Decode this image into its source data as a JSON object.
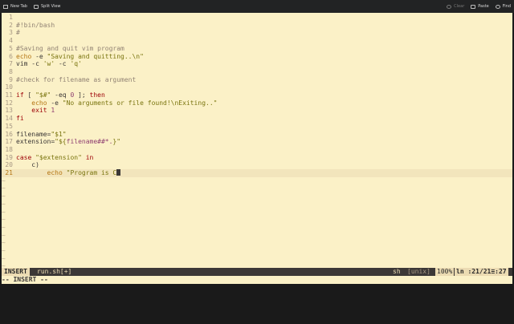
{
  "toolbar": {
    "new_tab": "New Tab",
    "split_view": "Split View",
    "clear": "Clear",
    "paste": "Paste",
    "find": "Find"
  },
  "editor": {
    "lines": [
      {
        "n": "1",
        "tokens": []
      },
      {
        "n": "2",
        "tokens": [
          {
            "c": "cm",
            "t": "#!bin/bash"
          }
        ]
      },
      {
        "n": "3",
        "tokens": [
          {
            "c": "cm",
            "t": "#"
          }
        ]
      },
      {
        "n": "4",
        "tokens": []
      },
      {
        "n": "5",
        "tokens": [
          {
            "c": "cm",
            "t": "#Saving and quit vim program"
          }
        ]
      },
      {
        "n": "6",
        "tokens": [
          {
            "c": "fn",
            "t": "echo"
          },
          {
            "c": "",
            "t": " -e "
          },
          {
            "c": "st",
            "t": "\"Saving and quitting..\\n\""
          }
        ]
      },
      {
        "n": "7",
        "tokens": [
          {
            "c": "",
            "t": "vim -c "
          },
          {
            "c": "st",
            "t": "'w'"
          },
          {
            "c": "",
            "t": " -c "
          },
          {
            "c": "st",
            "t": "'q'"
          }
        ]
      },
      {
        "n": "8",
        "tokens": []
      },
      {
        "n": "9",
        "tokens": [
          {
            "c": "cm",
            "t": "#check for filename as argument"
          }
        ]
      },
      {
        "n": "10",
        "tokens": []
      },
      {
        "n": "11",
        "tokens": [
          {
            "c": "kw",
            "t": "if"
          },
          {
            "c": "",
            "t": " [ "
          },
          {
            "c": "st",
            "t": "\"$#\""
          },
          {
            "c": "",
            "t": " -eq "
          },
          {
            "c": "nm",
            "t": "0"
          },
          {
            "c": "",
            "t": " ]; "
          },
          {
            "c": "kw",
            "t": "then"
          }
        ]
      },
      {
        "n": "12",
        "tokens": [
          {
            "c": "",
            "t": "    "
          },
          {
            "c": "fn",
            "t": "echo"
          },
          {
            "c": "",
            "t": " -e "
          },
          {
            "c": "st",
            "t": "\"No arguments or file found!\\nExiting..\""
          }
        ]
      },
      {
        "n": "13",
        "tokens": [
          {
            "c": "",
            "t": "    "
          },
          {
            "c": "kw",
            "t": "exit"
          },
          {
            "c": "",
            "t": " "
          },
          {
            "c": "nm",
            "t": "1"
          }
        ]
      },
      {
        "n": "14",
        "tokens": [
          {
            "c": "kw",
            "t": "fi"
          }
        ]
      },
      {
        "n": "15",
        "tokens": []
      },
      {
        "n": "16",
        "tokens": [
          {
            "c": "",
            "t": "filename="
          },
          {
            "c": "st",
            "t": "\"$1\""
          }
        ]
      },
      {
        "n": "17",
        "tokens": [
          {
            "c": "",
            "t": "extension="
          },
          {
            "c": "st",
            "t": "\"${"
          },
          {
            "c": "ex",
            "t": "filename##*."
          },
          {
            "c": "st",
            "t": "}\""
          }
        ]
      },
      {
        "n": "18",
        "tokens": []
      },
      {
        "n": "19",
        "tokens": [
          {
            "c": "kw",
            "t": "case"
          },
          {
            "c": "",
            "t": " "
          },
          {
            "c": "st",
            "t": "\"$extension\""
          },
          {
            "c": "",
            "t": " "
          },
          {
            "c": "kw",
            "t": "in"
          }
        ]
      },
      {
        "n": "20",
        "tokens": [
          {
            "c": "",
            "t": "    c)"
          }
        ]
      },
      {
        "n": "21",
        "tokens": [
          {
            "c": "",
            "t": "        "
          },
          {
            "c": "fn",
            "t": "echo"
          },
          {
            "c": "",
            "t": " "
          },
          {
            "c": "st",
            "t": "\"Program is C"
          }
        ],
        "current": true
      }
    ],
    "filler": "~",
    "filler_count": 12
  },
  "statusline": {
    "mode": "INSERT",
    "file": "run.sh[+]",
    "filetype": "sh",
    "fileformat": "[unix]",
    "percent": "100%",
    "position": "ln :21/21≡:27"
  },
  "cmdline": "-- INSERT --"
}
